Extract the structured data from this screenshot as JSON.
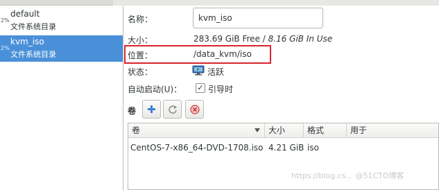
{
  "sidebar": {
    "pools": [
      {
        "percent": "2%",
        "name": "default",
        "type": "文件系统目录"
      },
      {
        "percent": "2%",
        "name": "kvm_iso",
        "type": "文件系统目录"
      }
    ]
  },
  "detail": {
    "name_label": "名称：",
    "name_value": "kvm_iso",
    "size_label": "大小：",
    "size_free": "283.69 GiB Free / ",
    "size_used": "8.16 GiB In Use",
    "location_label": "位置：",
    "location_value": "/data_kvm/iso",
    "state_label": "状态：",
    "state_value": "活跃",
    "autostart_label": "自动启动(U)：",
    "autostart_value": "引导时",
    "autostart_checked": "✓",
    "volumes_label": "卷"
  },
  "icons": {
    "state": "monitor-icon",
    "add_volume": "plus-icon",
    "refresh": "refresh-icon",
    "delete": "delete-icon"
  },
  "colors": {
    "selection": "#4a90d9",
    "highlight": "#d9232f",
    "add_icon": "#3f7fd6",
    "delete_icon": "#cc3b3b"
  },
  "volume_table": {
    "columns": [
      "卷",
      "大小",
      "格式",
      "用于"
    ],
    "rows": [
      {
        "name": "CentOS-7-x86_64-DVD-1708.iso",
        "size": "4.21 GiB",
        "format": "iso",
        "used_by": ""
      }
    ]
  },
  "watermark": "https://blog.cs... @51CTO博客"
}
